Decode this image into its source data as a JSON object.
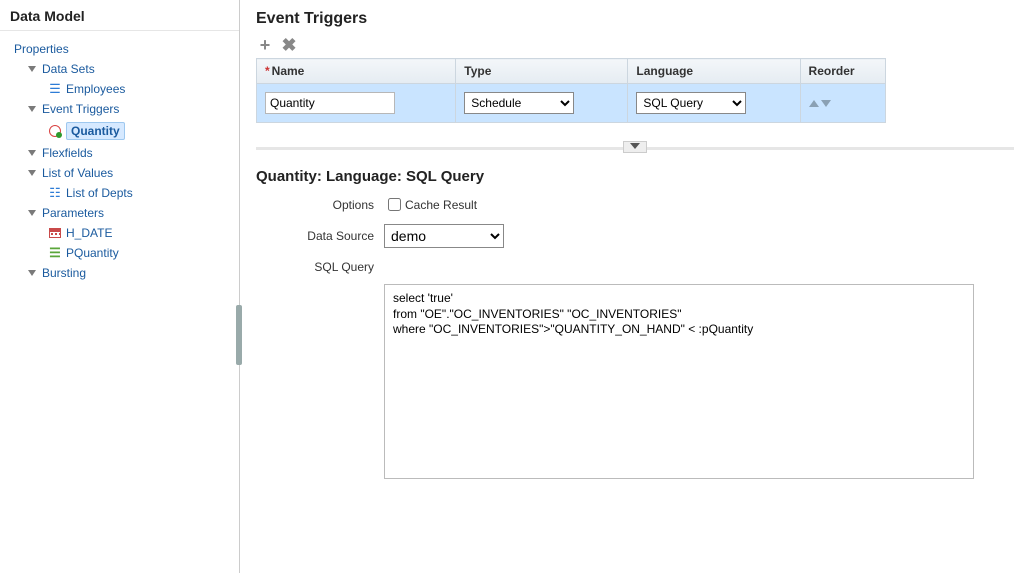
{
  "sidebar": {
    "title": "Data Model",
    "root": "Properties",
    "nodes": {
      "dataSets": {
        "label": "Data Sets",
        "children": [
          {
            "label": "Employees"
          }
        ]
      },
      "eventTriggers": {
        "label": "Event Triggers",
        "children": [
          {
            "label": "Quantity",
            "selected": true
          }
        ]
      },
      "flexfields": {
        "label": "Flexfields",
        "children": []
      },
      "listOfValues": {
        "label": "List of Values",
        "children": [
          {
            "label": "List of Depts"
          }
        ]
      },
      "parameters": {
        "label": "Parameters",
        "children": [
          {
            "label": "H_DATE"
          },
          {
            "label": "PQuantity"
          }
        ]
      },
      "bursting": {
        "label": "Bursting",
        "children": []
      }
    }
  },
  "main": {
    "title": "Event Triggers",
    "columns": {
      "name": "Name",
      "type": "Type",
      "language": "Language",
      "reorder": "Reorder"
    },
    "rows": [
      {
        "name": "Quantity",
        "type": "Schedule",
        "language": "SQL Query"
      }
    ]
  },
  "detail": {
    "title": "Quantity: Language: SQL Query",
    "labels": {
      "options": "Options",
      "cacheResult": "Cache Result",
      "dataSource": "Data Source",
      "sqlQuery": "SQL Query"
    },
    "cacheResult": false,
    "dataSource": "demo",
    "sql": "select 'true'\nfrom \"OE\".\"OC_INVENTORIES\" \"OC_INVENTORIES\"\nwhere \"OC_INVENTORIES\">\"QUANTITY_ON_HAND\" < :pQuantity"
  }
}
